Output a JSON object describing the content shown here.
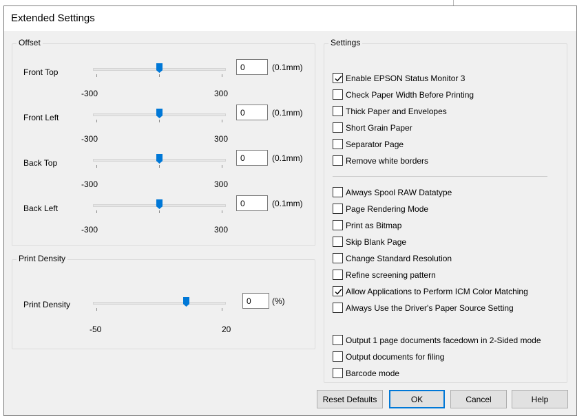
{
  "window": {
    "title": "Extended Settings"
  },
  "offset": {
    "group_label": "Offset",
    "rows": [
      {
        "label": "Front Top",
        "value": "0",
        "unit": "(0.1mm)",
        "min": "-300",
        "max": "300",
        "level": 0.5
      },
      {
        "label": "Front Left",
        "value": "0",
        "unit": "(0.1mm)",
        "min": "-300",
        "max": "300",
        "level": 0.5
      },
      {
        "label": "Back Top",
        "value": "0",
        "unit": "(0.1mm)",
        "min": "-300",
        "max": "300",
        "level": 0.5
      },
      {
        "label": "Back Left",
        "value": "0",
        "unit": "(0.1mm)",
        "min": "-300",
        "max": "300",
        "level": 0.5
      }
    ]
  },
  "print_density": {
    "group_label": "Print Density",
    "label": "Print Density",
    "value": "0",
    "unit": "(%)",
    "min": "-50",
    "max": "20",
    "level": 0.714
  },
  "settings": {
    "group_label": "Settings",
    "checkboxes": [
      {
        "label": "Enable EPSON Status Monitor 3",
        "checked": true
      },
      {
        "label": "Check Paper Width Before Printing",
        "checked": false
      },
      {
        "label": "Thick Paper and Envelopes",
        "checked": false
      },
      {
        "label": "Short Grain Paper",
        "checked": false
      },
      {
        "label": "Separator Page",
        "checked": false
      },
      {
        "label": "Remove white borders",
        "checked": false
      },
      {
        "label": "Always Spool RAW Datatype",
        "checked": false
      },
      {
        "label": "Page Rendering Mode",
        "checked": false
      },
      {
        "label": "Print as Bitmap",
        "checked": false
      },
      {
        "label": "Skip Blank Page",
        "checked": false
      },
      {
        "label": "Change Standard Resolution",
        "checked": false
      },
      {
        "label": "Refine screening pattern",
        "checked": false
      },
      {
        "label": "Allow Applications to Perform ICM Color Matching",
        "checked": true
      },
      {
        "label": "Always Use the Driver's Paper Source Setting",
        "checked": false
      },
      {
        "label": "Output 1 page documents facedown in 2-Sided mode",
        "checked": false
      },
      {
        "label": "Output documents for filing",
        "checked": false
      },
      {
        "label": "Barcode mode",
        "checked": false
      }
    ]
  },
  "buttons": {
    "reset": "Reset Defaults",
    "ok": "OK",
    "cancel": "Cancel",
    "help": "Help"
  },
  "colors": {
    "accent": "#0078d7",
    "dialog_bg": "#f0f0f0"
  }
}
